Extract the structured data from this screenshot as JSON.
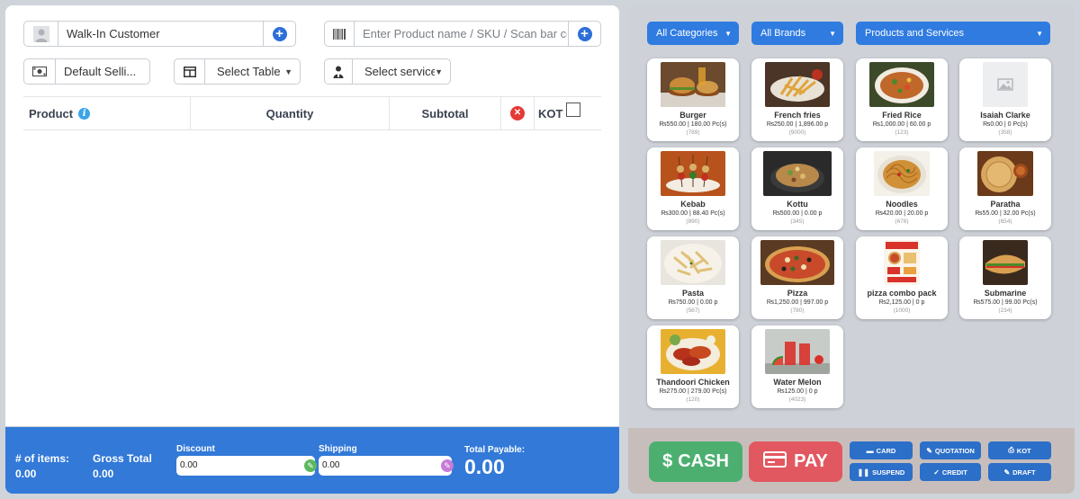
{
  "customer": {
    "value": "Walk-In Customer",
    "icon": "user-avatar-icon"
  },
  "search": {
    "placeholder": "Enter Product name / SKU / Scan bar code",
    "icon": "barcode-icon"
  },
  "selling_price": {
    "value": "Default Selli..."
  },
  "table_select": {
    "value": "Select Table"
  },
  "service_select": {
    "value": "Select service"
  },
  "table": {
    "headers": {
      "product": "Product",
      "quantity": "Quantity",
      "subtotal": "Subtotal",
      "kot": "KOT"
    }
  },
  "footer": {
    "items_label": "# of items:",
    "items_value": "0.00",
    "gross_label": "Gross Total",
    "gross_value": "0.00",
    "discount_label": "Discount",
    "discount_value": "0.00",
    "shipping_label": "Shipping",
    "shipping_value": "0.00",
    "payable_label": "Total Payable:",
    "payable_value": "0.00"
  },
  "filters": {
    "categories": "All Categories",
    "brands": "All Brands",
    "types": "Products and Services"
  },
  "products": [
    {
      "name": "Burger",
      "price": "₨550.00 | 180.00 Pc(s)",
      "code": "(789)"
    },
    {
      "name": "French fries",
      "price": "₨250.00 | 1,896.00 p",
      "code": "(9000)"
    },
    {
      "name": "Fried Rice",
      "price": "₨1,000.00 | 60.00 p",
      "code": "(123)"
    },
    {
      "name": "Isaiah Clarke",
      "price": "₨0.00 | 0 Pc(s)",
      "code": "(358)"
    },
    {
      "name": "Kebab",
      "price": "₨300.00 | 88.40 Pc(s)",
      "code": "(890)"
    },
    {
      "name": "Kottu",
      "price": "₨500.00 | 0.00 p",
      "code": "(345)"
    },
    {
      "name": "Noodles",
      "price": "₨420.00 | 20.00 p",
      "code": "(678)"
    },
    {
      "name": "Paratha",
      "price": "₨55.00 | 32.00 Pc(s)",
      "code": "(654)"
    },
    {
      "name": "Pasta",
      "price": "₨750.00 | 0.00 p",
      "code": "(567)"
    },
    {
      "name": "Pizza",
      "price": "₨1,250.00 | 997.00 p",
      "code": "(780)"
    },
    {
      "name": "pizza combo pack",
      "price": "₨2,125.00 | 0 p",
      "code": "(1000)"
    },
    {
      "name": "Submarine",
      "price": "₨575.00 | 99.00 Pc(s)",
      "code": "(234)"
    },
    {
      "name": "Thandoori Chicken",
      "price": "₨275.00 | 279.00 Pc(s)",
      "code": "(120)"
    },
    {
      "name": "Water Melon",
      "price": "₨125.00 | 0 p",
      "code": "(4023)"
    }
  ],
  "actions": {
    "cash": "CASH",
    "pay": "PAY",
    "card": "CARD",
    "quotation": "QUOTATION",
    "kot": "KOT",
    "suspend": "SUSPEND",
    "credit": "CREDIT",
    "draft": "DRAFT"
  },
  "colors": {
    "primary": "#3279d8",
    "cash": "#4caf70",
    "pay": "#e25860",
    "danger": "#e53935"
  }
}
